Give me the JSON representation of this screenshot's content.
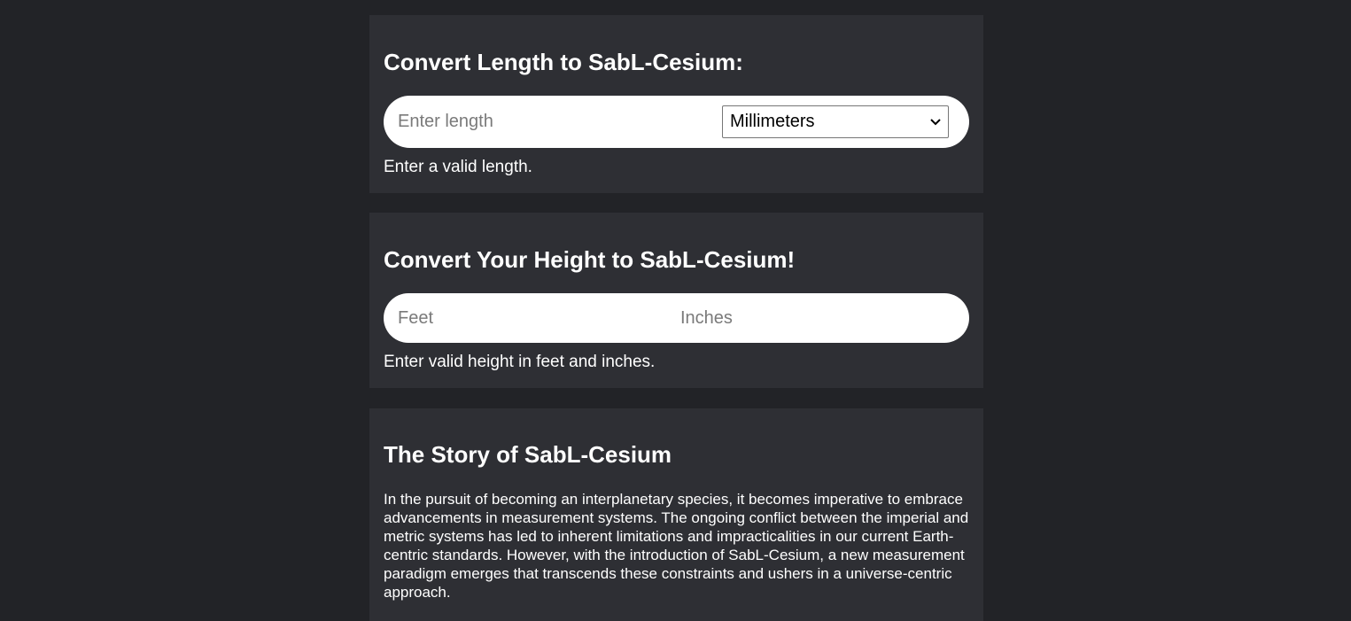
{
  "length_converter": {
    "title": "Convert Length to SabL-Cesium:",
    "input_placeholder": "Enter length",
    "unit_selected": "Millimeters",
    "message": "Enter a valid length."
  },
  "height_converter": {
    "title": "Convert Your Height to SabL-Cesium!",
    "feet_placeholder": "Feet",
    "inches_placeholder": "Inches",
    "message": "Enter valid height in feet and inches."
  },
  "story": {
    "title": "The Story of SabL-Cesium",
    "paragraph": "In the pursuit of becoming an interplanetary species, it becomes imperative to embrace advancements in measurement systems. The ongoing conflict between the imperial and metric systems has led to inherent limitations and impracticalities in our current Earth-centric standards. However, with the introduction of SabL-Cesium, a new measurement paradigm emerges that transcends these constraints and ushers in a universe-centric approach."
  },
  "icons": {
    "select_chevron": "chevron-down-icon"
  }
}
